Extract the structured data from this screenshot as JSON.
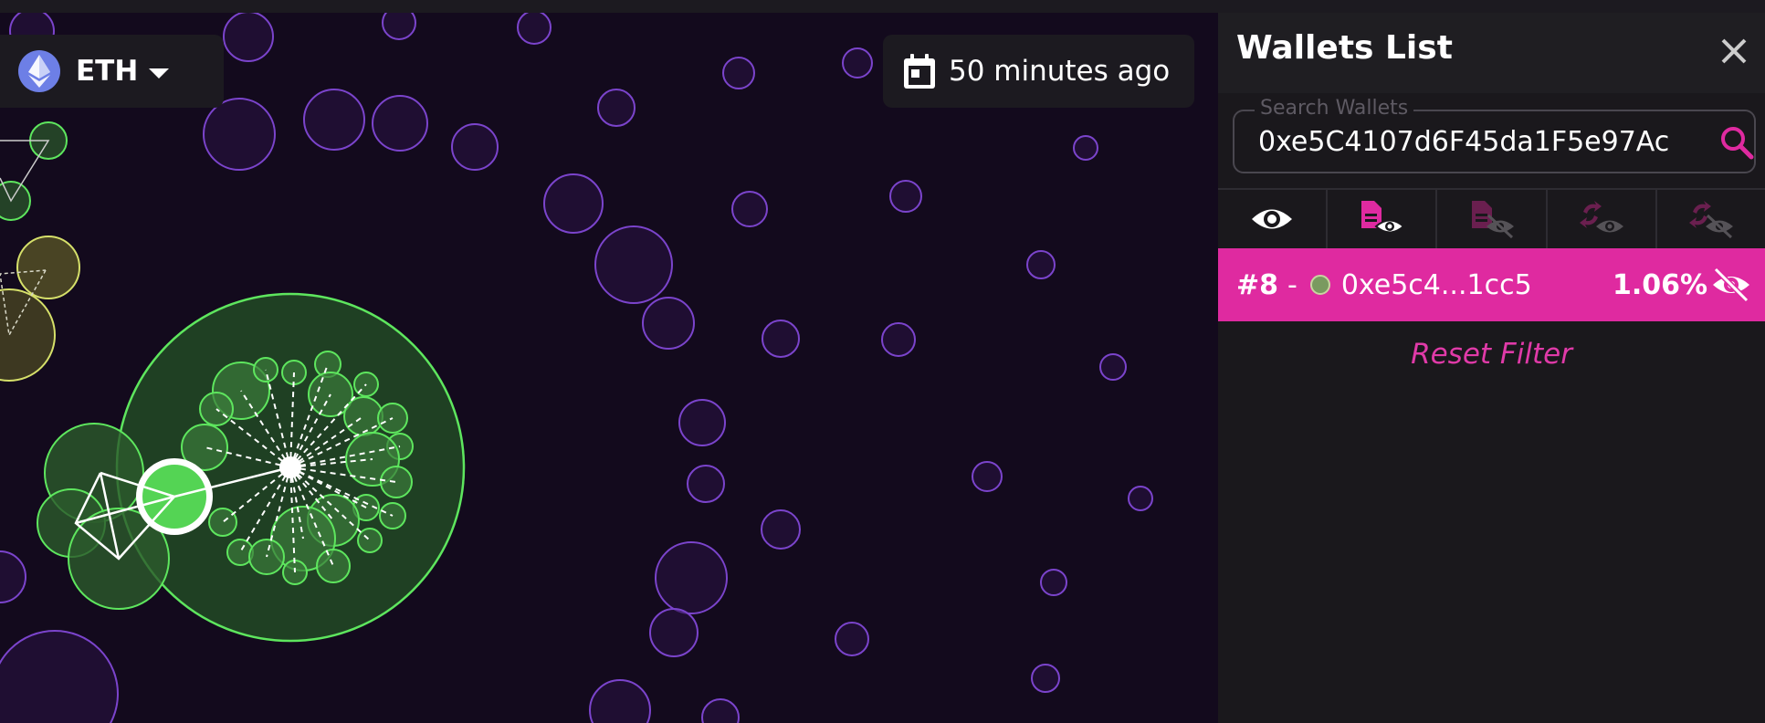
{
  "chain": {
    "label": "ETH",
    "icon": "ethereum-icon"
  },
  "time": {
    "label": "50 minutes ago",
    "icon": "calendar-icon"
  },
  "panel": {
    "title": "Wallets List",
    "search": {
      "legend": "Search Wallets",
      "value": "0xe5C4107d6F45da1F5e97Ac",
      "icon": "search-icon"
    },
    "filters": [
      {
        "name": "show-all",
        "icon": "eye-icon"
      },
      {
        "name": "contracts-visible",
        "icon": "contract-eye-icon"
      },
      {
        "name": "contracts-hidden",
        "icon": "contract-eye-off-icon"
      },
      {
        "name": "exchanges-visible",
        "icon": "exchange-eye-icon"
      },
      {
        "name": "exchanges-hidden",
        "icon": "exchange-eye-off-icon"
      }
    ],
    "wallets": [
      {
        "rank": "#8",
        "sep": "-",
        "address": "0xe5c4...1cc5",
        "percent": "1.06%"
      }
    ],
    "reset": "Reset Filter"
  },
  "colors": {
    "accent": "#df2aa0",
    "green": "#5ee65e",
    "purple": "#7b3fc4"
  }
}
